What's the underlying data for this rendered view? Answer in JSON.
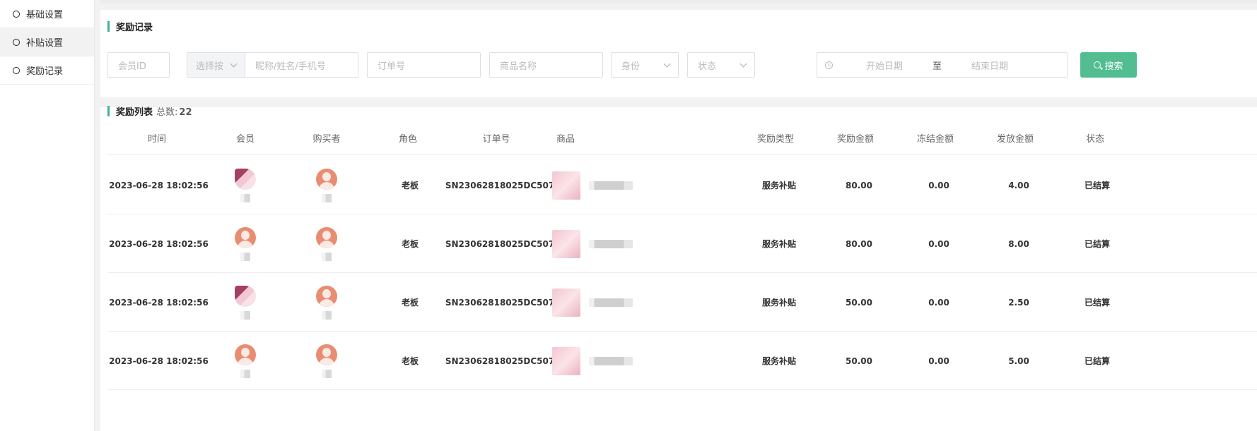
{
  "sidebar": {
    "items": [
      {
        "label": "基础设置"
      },
      {
        "label": "补贴设置"
      },
      {
        "label": "奖励记录"
      }
    ]
  },
  "filter": {
    "title": "奖励记录",
    "member_id_placeholder": "会员ID",
    "select_prefix": "选择按",
    "name_placeholder": "昵称/姓名/手机号",
    "order_placeholder": "订单号",
    "goods_placeholder": "商品名称",
    "identity_placeholder": "身份",
    "status_placeholder": "状态",
    "date_start": "开始日期",
    "date_sep": "至",
    "date_end": "结束日期",
    "search_label": "搜索"
  },
  "list": {
    "title": "奖励列表",
    "total_label": "总数:",
    "total_value": "22",
    "columns": [
      "时间",
      "会员",
      "购买者",
      "角色",
      "订单号",
      "商品",
      "奖励类型",
      "奖励金额",
      "冻结金额",
      "发放金额",
      "状态"
    ],
    "rows": [
      {
        "time": "2023-06-28 18:02:56",
        "member_avatar": "photo",
        "buyer_avatar": "default",
        "role": "老板",
        "order": "SN23062818025DC507",
        "reward_type": "服务补贴",
        "reward_amount": "80.00",
        "frozen": "0.00",
        "issued": "4.00",
        "status": "已结算"
      },
      {
        "time": "2023-06-28 18:02:56",
        "member_avatar": "default",
        "buyer_avatar": "default",
        "role": "老板",
        "order": "SN23062818025DC507",
        "reward_type": "服务补贴",
        "reward_amount": "80.00",
        "frozen": "0.00",
        "issued": "8.00",
        "status": "已结算"
      },
      {
        "time": "2023-06-28 18:02:56",
        "member_avatar": "photo",
        "buyer_avatar": "default",
        "role": "老板",
        "order": "SN23062818025DC507",
        "reward_type": "服务补贴",
        "reward_amount": "50.00",
        "frozen": "0.00",
        "issued": "2.50",
        "status": "已结算"
      },
      {
        "time": "2023-06-28 18:02:56",
        "member_avatar": "default",
        "buyer_avatar": "default",
        "role": "老板",
        "order": "SN23062818025DC507",
        "reward_type": "服务补贴",
        "reward_amount": "50.00",
        "frozen": "0.00",
        "issued": "5.00",
        "status": "已结算"
      }
    ]
  },
  "colors": {
    "accent": "#52bd91",
    "title_bar": "#3fb58a",
    "avatar_default": "#e88c72"
  }
}
